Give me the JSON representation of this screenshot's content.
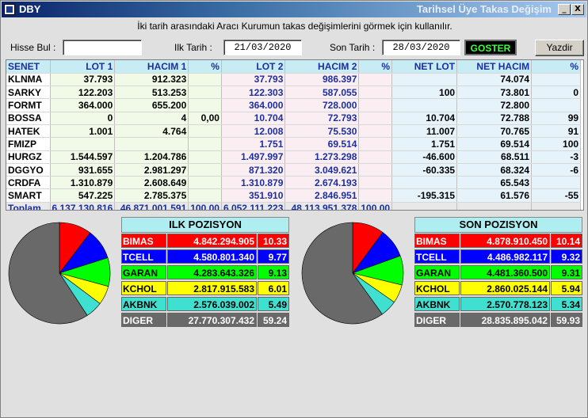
{
  "window": {
    "title": "DBY",
    "title_right": "Tarihsel Üye Takas Değişim",
    "minimize_label": "_",
    "close_label": "X"
  },
  "instruction": "İki tarih arasındaki  Aracı Kurumun takas değişimlerini görmek için kullanılır.",
  "controls": {
    "hisse_bul_label": "Hisse Bul :",
    "hisse_bul_value": "",
    "ilk_tarih_label": "Ilk Tarih :",
    "ilk_tarih_value": "21/03/2020",
    "son_tarih_label": "Son Tarih :",
    "son_tarih_value": "28/03/2020",
    "goster_label": "GOSTER",
    "yazdir_label": "Yazdir"
  },
  "table": {
    "headers": [
      "SENET",
      "LOT 1",
      "HACIM 1",
      "%",
      "LOT 2",
      "HACIM 2",
      "%",
      "NET LOT",
      "NET HACIM",
      "%"
    ],
    "rows": [
      [
        "KLNMA",
        "37.793",
        "912.323",
        "",
        "37.793",
        "986.397",
        "",
        "",
        "74.074",
        ""
      ],
      [
        "SARKY",
        "122.203",
        "513.253",
        "",
        "122.303",
        "587.055",
        "",
        "100",
        "73.801",
        "0"
      ],
      [
        "FORMT",
        "364.000",
        "655.200",
        "",
        "364.000",
        "728.000",
        "",
        "",
        "72.800",
        ""
      ],
      [
        "BOSSA",
        "0",
        "4",
        "0,00",
        "10.704",
        "72.793",
        "",
        "10.704",
        "72.788",
        "99"
      ],
      [
        "HATEK",
        "1.001",
        "4.764",
        "",
        "12.008",
        "75.530",
        "",
        "11.007",
        "70.765",
        "91"
      ],
      [
        "FMIZP",
        "",
        "",
        "",
        "1.751",
        "69.514",
        "",
        "1.751",
        "69.514",
        "100"
      ],
      [
        "HURGZ",
        "1.544.597",
        "1.204.786",
        "",
        "1.497.997",
        "1.273.298",
        "",
        "-46.600",
        "68.511",
        "-3"
      ],
      [
        "DGGYO",
        "931.655",
        "2.981.297",
        "",
        "871.320",
        "3.049.621",
        "",
        "-60.335",
        "68.324",
        "-6"
      ],
      [
        "CRDFA",
        "1.310.879",
        "2.608.649",
        "",
        "1.310.879",
        "2.674.193",
        "",
        "",
        "65.543",
        ""
      ],
      [
        "SMART",
        "547.225",
        "2.785.375",
        "",
        "351.910",
        "2.846.951",
        "",
        "-195.315",
        "61.576",
        "-55"
      ]
    ],
    "total": [
      "Toplam",
      "6.137.130.816",
      "46.871.001.591",
      "100,00",
      "6.052.111.223",
      "48.113.951.378",
      "100,00",
      "",
      "",
      ""
    ]
  },
  "ilk_pozisyon": {
    "title": "ILK POZISYON",
    "items": [
      {
        "name": "BIMAS",
        "value": "4.842.294.905",
        "pct": "10.33",
        "share": 10.33,
        "color": "#ff0000",
        "text_color": "#ffffff"
      },
      {
        "name": "TCELL",
        "value": "4.580.801.340",
        "pct": "9.77",
        "share": 9.77,
        "color": "#0000ff",
        "text_color": "#ffffff"
      },
      {
        "name": "GARAN",
        "value": "4.283.643.326",
        "pct": "9.13",
        "share": 9.13,
        "color": "#00ff00",
        "text_color": "#000000"
      },
      {
        "name": "KCHOL",
        "value": "2.817.915.583",
        "pct": "6.01",
        "share": 6.01,
        "color": "#ffff00",
        "text_color": "#000000"
      },
      {
        "name": "AKBNK",
        "value": "2.576.039.002",
        "pct": "5.49",
        "share": 5.49,
        "color": "#40e0d0",
        "text_color": "#000000"
      },
      {
        "name": "DIGER",
        "value": "27.770.307.432",
        "pct": "59.24",
        "share": 59.24,
        "color": "#696969",
        "text_color": "#ffffff"
      }
    ]
  },
  "son_pozisyon": {
    "title": "SON POZISYON",
    "items": [
      {
        "name": "BIMAS",
        "value": "4.878.910.450",
        "pct": "10.14",
        "share": 10.14,
        "color": "#ff0000",
        "text_color": "#ffffff"
      },
      {
        "name": "TCELL",
        "value": "4.486.982.117",
        "pct": "9.32",
        "share": 9.32,
        "color": "#0000ff",
        "text_color": "#ffffff"
      },
      {
        "name": "GARAN",
        "value": "4.481.360.500",
        "pct": "9.31",
        "share": 9.31,
        "color": "#00ff00",
        "text_color": "#000000"
      },
      {
        "name": "KCHOL",
        "value": "2.860.025.144",
        "pct": "5.94",
        "share": 5.94,
        "color": "#ffff00",
        "text_color": "#000000"
      },
      {
        "name": "AKBNK",
        "value": "2.570.778.123",
        "pct": "5.34",
        "share": 5.34,
        "color": "#40e0d0",
        "text_color": "#000000"
      },
      {
        "name": "DIGER",
        "value": "28.835.895.042",
        "pct": "59.93",
        "share": 59.93,
        "color": "#696969",
        "text_color": "#ffffff"
      }
    ]
  }
}
